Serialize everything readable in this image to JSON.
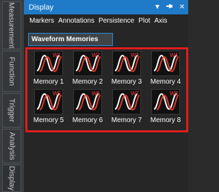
{
  "side_tabs": [
    "Measurement",
    "Function",
    "Trigger",
    "Analysis",
    "Display"
  ],
  "panel": {
    "title": "Display",
    "controls": [
      "dropdown-icon",
      "pin-icon",
      "close-icon"
    ],
    "menu": [
      "Markers",
      "Annotations",
      "Persistence",
      "Plot",
      "Axis"
    ],
    "section_button": "Waveform Memories"
  },
  "memories": [
    {
      "tag": "W1",
      "label": "Memory 1"
    },
    {
      "tag": "W2",
      "label": "Memory 2"
    },
    {
      "tag": "W3",
      "label": "Memory 3"
    },
    {
      "tag": "W4",
      "label": "Memory 4"
    },
    {
      "tag": "W5",
      "label": "Memory 5"
    },
    {
      "tag": "W6",
      "label": "Memory 6"
    },
    {
      "tag": "W7",
      "label": "Memory 7"
    },
    {
      "tag": "W8",
      "label": "Memory 8"
    }
  ],
  "colors": {
    "accent": "#1f7ac8",
    "highlight": "#e21d1d",
    "wave_white": "#ffffff",
    "wave_red": "#e03a2b"
  }
}
